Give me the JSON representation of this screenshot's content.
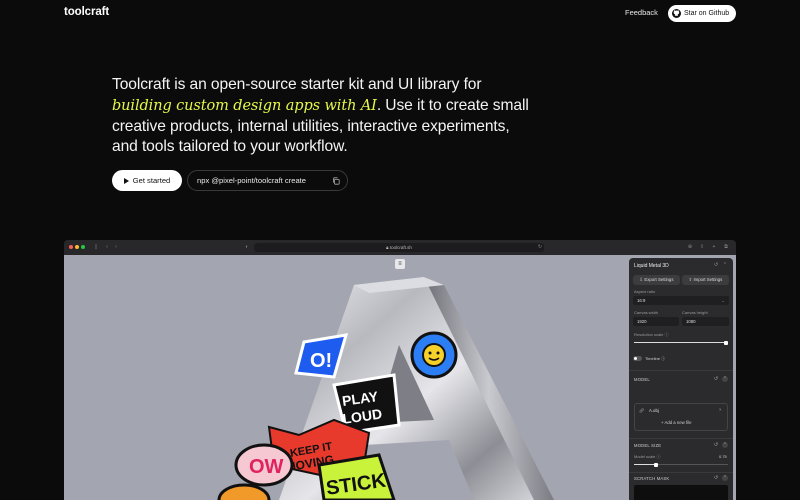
{
  "nav": {
    "brand": "toolcraft",
    "feedback": "Feedback",
    "github": "Star on Github"
  },
  "hero": {
    "line_pre": "Toolcraft is an open-source starter kit and UI library for ",
    "highlight": "building custom design apps with AI",
    "line_post": ". Use it to create small creative products, internal utilities, interactive experiments, and tools tailored to your workflow."
  },
  "actions": {
    "get_started": "Get started",
    "command": "npx @pixel-point/toolcraft create"
  },
  "browser": {
    "url": "toolcraft.sh"
  },
  "panel": {
    "title": "Liquid Metal 3D",
    "export": "Export Settings",
    "import": "Import Settings",
    "aspect_label": "Aspect ratio",
    "aspect_value": "16:9",
    "canvas_width_label": "Canvas width",
    "canvas_width": "1920",
    "canvas_height_label": "Canvas height",
    "canvas_height": "1080",
    "resolution_label": "Resolution scale",
    "resolution_fraction": 1.0,
    "timeline": "Timeline",
    "model_section": "MODEL",
    "file_name": "A.obj",
    "add_file": "Add a new file",
    "model_size_section": "MODEL SIZE",
    "model_scale_label": "Model scale",
    "model_scale_value": "0.75",
    "model_scale_fraction": 0.25,
    "scratch_section": "SCRATCH MASK"
  },
  "colors": {
    "background": "#0b0b0b",
    "accent_highlight": "#e6f94a",
    "canvas": "#a3a5b0",
    "panel": "#2b2b2d"
  },
  "icons": {
    "github": "github-icon",
    "play": "play-icon",
    "copy": "copy-icon"
  }
}
